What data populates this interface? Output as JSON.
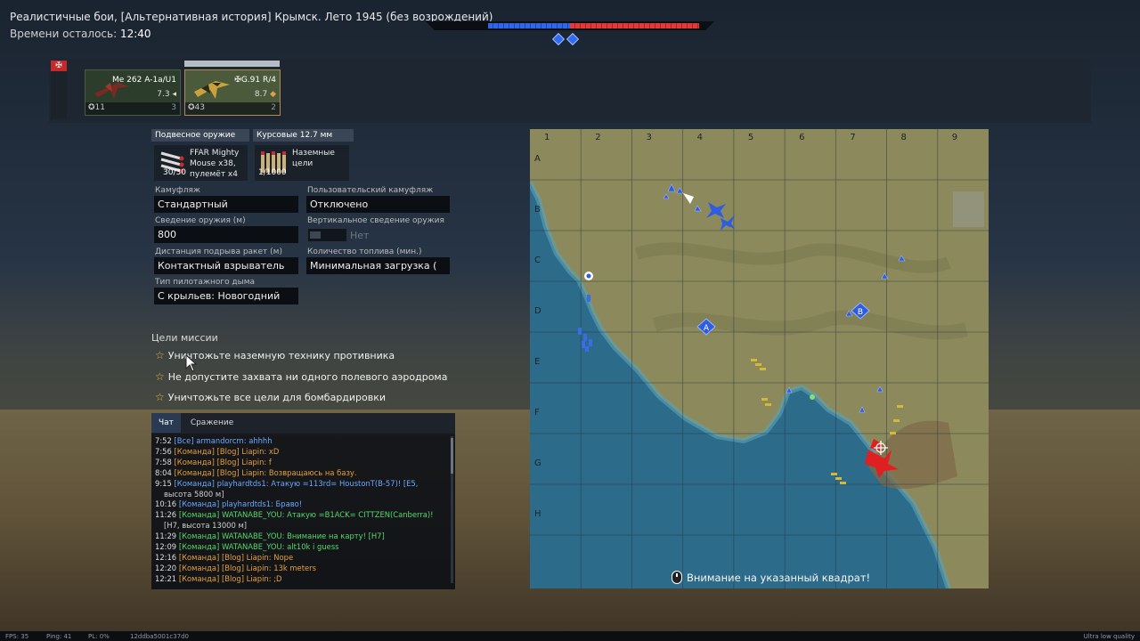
{
  "hud": {
    "mission_title": "Реалистичные бои, [Альтернативная история] Крымск. Лето 1945 (без возрождений)",
    "time_label": "Времени осталось:",
    "time_value": "12:40"
  },
  "score": {
    "blue_fraction": 0.36,
    "red_fraction": 0.57,
    "zones_captured": [
      "A",
      "B"
    ]
  },
  "slots": [
    {
      "name": "Me 262 A-1a/U1",
      "br": "7.3",
      "left": "11",
      "right": "3",
      "selected": false
    },
    {
      "name": "G.91 R/4",
      "br": "8.7",
      "left": "43",
      "right": "2",
      "selected": true
    }
  ],
  "weapons": {
    "tab_secondary": "Подвесное оружие",
    "tab_guns": "Курсовые 12.7 мм",
    "secondary_line1": "FFAR Mighty",
    "secondary_line2": "Mouse x38,",
    "secondary_line3": "пулемёт x4",
    "secondary_count": "30/30",
    "guns_line1": "Наземные",
    "guns_line2": "цели",
    "guns_count": "1/1000"
  },
  "settings": {
    "camo_label": "Камуфляж",
    "camo_value": "Стандартный",
    "user_camo_label": "Пользовательский камуфляж",
    "user_camo_value": "Отключено",
    "convergence_label": "Сведение оружия (м)",
    "convergence_value": "800",
    "vertical_label": "Вертикальное сведение оружия",
    "vertical_value": "Нет",
    "rocket_label": "Дистанция подрыва ракет (м)",
    "rocket_value": "Контактный взрыватель",
    "fuel_label": "Количество топлива (мин.)",
    "fuel_value": "Минимальная загрузка (",
    "smoke_label": "Тип пилотажного дыма",
    "smoke_value": "С крыльев: Новогодний"
  },
  "mission": {
    "heading": "Цели миссии",
    "objectives": [
      "Уничтожьте наземную технику противника",
      "Не допустите захвата ни одного полевого аэродрома",
      "Уничтожьте все цели для бомбардировки"
    ]
  },
  "chat": {
    "tab_chat": "Чат",
    "tab_battle": "Сражение",
    "lines": [
      {
        "time": "7:52",
        "channel": "[Все]",
        "user": "armandorcm:",
        "msg": "ahhhh",
        "type": "all"
      },
      {
        "time": "7:56",
        "channel": "[Команда]",
        "user": "[Blog] Liapin:",
        "msg": "xD",
        "type": "team"
      },
      {
        "time": "7:58",
        "channel": "[Команда]",
        "user": "[Blog] Liapin:",
        "msg": "f",
        "type": "team"
      },
      {
        "time": "8:04",
        "channel": "[Команда]",
        "user": "[Blog] Liapin:",
        "msg": "Возвращаюсь на базу.",
        "type": "team"
      },
      {
        "time": "9:15",
        "channel": "[Команда]",
        "user": "playhardtds1:",
        "msg": "Атакую =113rd= HoustonT(B-57)! [E5,",
        "type": "blue"
      },
      {
        "time": "",
        "channel": "",
        "user": "",
        "msg": "высота 5800 м]",
        "type": "cont"
      },
      {
        "time": "10:16",
        "channel": "[Команда]",
        "user": "playhardtds1:",
        "msg": "Браво!",
        "type": "blue"
      },
      {
        "time": "11:26",
        "channel": "[Команда]",
        "user": "WATANABE_YOU:",
        "msg": "Атакую =B1ACK= CITTZEN(Canberra)!",
        "type": "green"
      },
      {
        "time": "",
        "channel": "",
        "user": "",
        "msg": "[H7, высота 13000 м]",
        "type": "cont"
      },
      {
        "time": "11:29",
        "channel": "[Команда]",
        "user": "WATANABE_YOU:",
        "msg": "Внимание на карту! [H7]",
        "type": "green"
      },
      {
        "time": "12:09",
        "channel": "[Команда]",
        "user": "WATANABE_YOU:",
        "msg": "alt10k i guess",
        "type": "green"
      },
      {
        "time": "12:16",
        "channel": "[Команда]",
        "user": "[Blog] Liapin:",
        "msg": "Nope",
        "type": "team"
      },
      {
        "time": "12:20",
        "channel": "[Команда]",
        "user": "[Blog] Liapin:",
        "msg": "13k meters",
        "type": "team"
      },
      {
        "time": "12:21",
        "channel": "[Команда]",
        "user": "[Blog] Liapin:",
        "msg": ";D",
        "type": "team"
      }
    ]
  },
  "map": {
    "columns": [
      "1",
      "2",
      "3",
      "4",
      "5",
      "6",
      "7",
      "8",
      "9"
    ],
    "rows": [
      "A",
      "B",
      "C",
      "D",
      "E",
      "F",
      "G",
      "H"
    ],
    "zone_labels": [
      "A",
      "B"
    ],
    "notice": "Внимание на указанный квадрат!",
    "colors": {
      "sea": "#2f6f8e",
      "land": "#8a8a5a",
      "blue_team": "#2f5de0",
      "red_team": "#e02020",
      "ground_units": "#d4b83a"
    }
  },
  "status": {
    "fps": "FPS: 35",
    "ping": "Ping: 41",
    "pl": "PL: 0%",
    "session": "12ddba5001c37d0",
    "quality": "Ultra low quality"
  }
}
